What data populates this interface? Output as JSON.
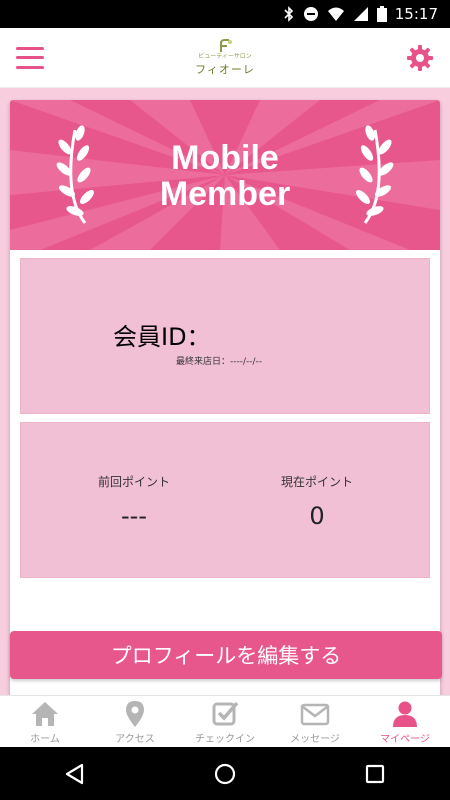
{
  "status_bar": {
    "time": "15:17",
    "icons": [
      "bluetooth-icon",
      "do-not-disturb-icon",
      "wifi-icon",
      "signal-icon",
      "battery-icon"
    ]
  },
  "app_bar": {
    "logo_sub": "ビューティーサロン",
    "logo_text": "フィオーレ"
  },
  "banner": {
    "title_line1": "Mobile",
    "title_line2": "Member"
  },
  "member": {
    "id_label": "会員ID：",
    "last_visit": "最終来店日：----/--/--"
  },
  "points": {
    "previous_label": "前回ポイント",
    "previous_value": "---",
    "current_label": "現在ポイント",
    "current_value": "0"
  },
  "edit_profile_label": "プロフィールを編集する",
  "tabs": [
    {
      "label": "ホーム",
      "icon": "home-icon"
    },
    {
      "label": "アクセス",
      "icon": "map-pin-icon"
    },
    {
      "label": "チェックイン",
      "icon": "checkbox-icon"
    },
    {
      "label": "メッセージ",
      "icon": "mail-icon"
    },
    {
      "label": "マイページ",
      "icon": "user-icon",
      "active": true
    }
  ],
  "colors": {
    "accent": "#e8578c",
    "panel": "#f2c0d4",
    "tab_inactive": "#999999"
  }
}
